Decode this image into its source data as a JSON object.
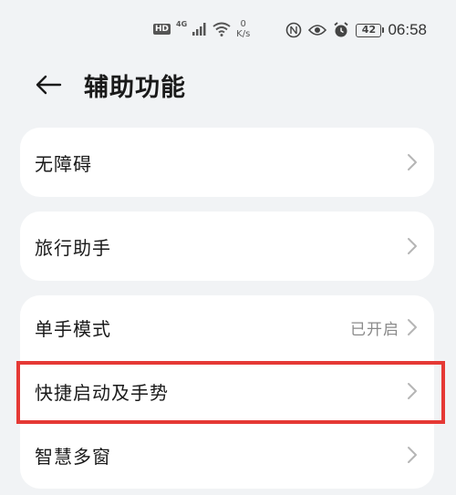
{
  "status_bar": {
    "hd": "HD",
    "network": "4G",
    "speed_value": "0",
    "speed_unit": "K/s",
    "battery": "42",
    "time": "06:58",
    "icons": [
      "hd-icon",
      "signal-icon",
      "wifi-icon",
      "nfc-icon",
      "eye-comfort-icon",
      "alarm-icon",
      "battery-icon"
    ]
  },
  "header": {
    "title": "辅助功能",
    "back_icon": "arrow-left-icon"
  },
  "groups": [
    {
      "items": [
        {
          "label": "无障碍",
          "value": ""
        }
      ]
    },
    {
      "items": [
        {
          "label": "旅行助手",
          "value": ""
        }
      ]
    },
    {
      "items": [
        {
          "label": "单手模式",
          "value": "已开启"
        },
        {
          "label": "快捷启动及手势",
          "value": ""
        },
        {
          "label": "智慧多窗",
          "value": ""
        }
      ]
    }
  ],
  "colors": {
    "background": "#f1f3f5",
    "card": "#ffffff",
    "highlight": "#e53935",
    "secondary_text": "#8a8a8a"
  }
}
